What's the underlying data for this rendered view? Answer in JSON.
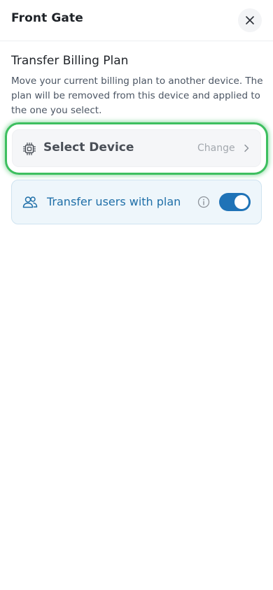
{
  "header": {
    "title": "Front Gate",
    "close_icon": "close-icon"
  },
  "section": {
    "title": "Transfer Billing Plan",
    "description": "Move your current billing plan to another device. The plan will be removed from this device and applied to the one you select."
  },
  "device_selector": {
    "label": "Select Device",
    "action_label": "Change",
    "icon": "chip-icon",
    "highlight_color": "#3dbf5f"
  },
  "transfer_users": {
    "label": "Transfer users with plan",
    "icon": "users-icon",
    "info_icon": "info-icon",
    "toggle_on": true,
    "accent_color": "#1f73b7"
  }
}
